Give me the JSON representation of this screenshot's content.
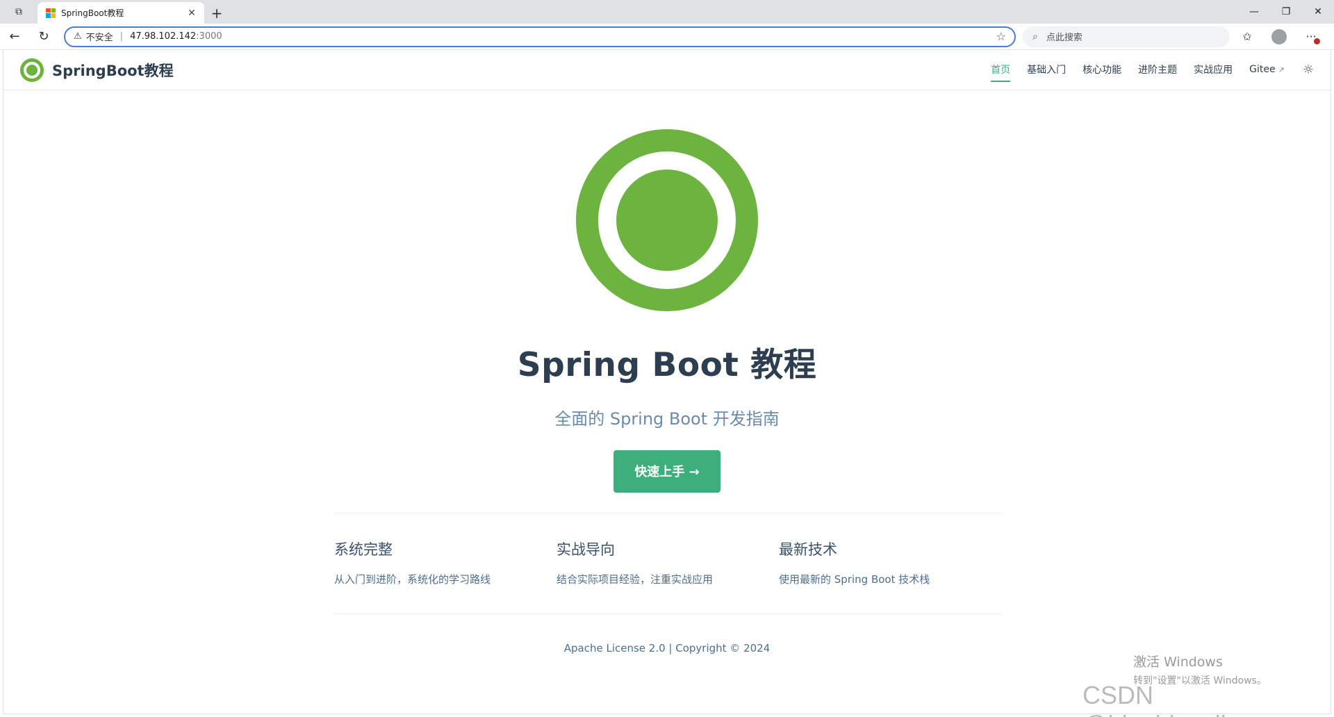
{
  "browser": {
    "tab_title": "SpringBoot教程",
    "security_label": "不安全",
    "address_host": "47.98.102.142",
    "address_port": ":3000",
    "search_placeholder": "点此搜索"
  },
  "site": {
    "brand": "SpringBoot教程",
    "nav": [
      {
        "label": "首页"
      },
      {
        "label": "基础入门"
      },
      {
        "label": "核心功能"
      },
      {
        "label": "进阶主题"
      },
      {
        "label": "实战应用"
      },
      {
        "label": "Gitee"
      }
    ],
    "external_glyph": "↗"
  },
  "hero": {
    "title": "Spring Boot 教程",
    "description": "全面的 Spring Boot 开发指南",
    "action": "快速上手 →"
  },
  "features": [
    {
      "title": "系统完整",
      "details": "从入门到进阶，系统化的学习路线"
    },
    {
      "title": "实战导向",
      "details": "结合实际项目经验，注重实战应用"
    },
    {
      "title": "最新技术",
      "details": "使用最新的 Spring Boot 技术栈"
    }
  ],
  "footer": "Apache License 2.0 | Copyright © 2024",
  "overlays": {
    "activation_line1": "激活 Windows",
    "activation_line2": "转到\"设置\"以激活 Windows。",
    "watermark": "CSDN @bingbingyihao"
  },
  "colors": {
    "spring_green": "#6db33f",
    "accent": "#3eaf7c",
    "text": "#2c3e50"
  }
}
